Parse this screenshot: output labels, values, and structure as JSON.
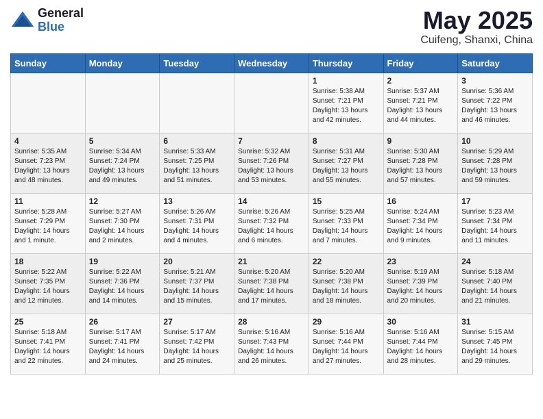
{
  "logo": {
    "general": "General",
    "blue": "Blue"
  },
  "title": "May 2025",
  "subtitle": "Cuifeng, Shanxi, China",
  "days_of_week": [
    "Sunday",
    "Monday",
    "Tuesday",
    "Wednesday",
    "Thursday",
    "Friday",
    "Saturday"
  ],
  "weeks": [
    [
      {
        "day": "",
        "info": ""
      },
      {
        "day": "",
        "info": ""
      },
      {
        "day": "",
        "info": ""
      },
      {
        "day": "",
        "info": ""
      },
      {
        "day": "1",
        "info": "Sunrise: 5:38 AM\nSunset: 7:21 PM\nDaylight: 13 hours\nand 42 minutes."
      },
      {
        "day": "2",
        "info": "Sunrise: 5:37 AM\nSunset: 7:21 PM\nDaylight: 13 hours\nand 44 minutes."
      },
      {
        "day": "3",
        "info": "Sunrise: 5:36 AM\nSunset: 7:22 PM\nDaylight: 13 hours\nand 46 minutes."
      }
    ],
    [
      {
        "day": "4",
        "info": "Sunrise: 5:35 AM\nSunset: 7:23 PM\nDaylight: 13 hours\nand 48 minutes."
      },
      {
        "day": "5",
        "info": "Sunrise: 5:34 AM\nSunset: 7:24 PM\nDaylight: 13 hours\nand 49 minutes."
      },
      {
        "day": "6",
        "info": "Sunrise: 5:33 AM\nSunset: 7:25 PM\nDaylight: 13 hours\nand 51 minutes."
      },
      {
        "day": "7",
        "info": "Sunrise: 5:32 AM\nSunset: 7:26 PM\nDaylight: 13 hours\nand 53 minutes."
      },
      {
        "day": "8",
        "info": "Sunrise: 5:31 AM\nSunset: 7:27 PM\nDaylight: 13 hours\nand 55 minutes."
      },
      {
        "day": "9",
        "info": "Sunrise: 5:30 AM\nSunset: 7:28 PM\nDaylight: 13 hours\nand 57 minutes."
      },
      {
        "day": "10",
        "info": "Sunrise: 5:29 AM\nSunset: 7:28 PM\nDaylight: 13 hours\nand 59 minutes."
      }
    ],
    [
      {
        "day": "11",
        "info": "Sunrise: 5:28 AM\nSunset: 7:29 PM\nDaylight: 14 hours\nand 1 minute."
      },
      {
        "day": "12",
        "info": "Sunrise: 5:27 AM\nSunset: 7:30 PM\nDaylight: 14 hours\nand 2 minutes."
      },
      {
        "day": "13",
        "info": "Sunrise: 5:26 AM\nSunset: 7:31 PM\nDaylight: 14 hours\nand 4 minutes."
      },
      {
        "day": "14",
        "info": "Sunrise: 5:26 AM\nSunset: 7:32 PM\nDaylight: 14 hours\nand 6 minutes."
      },
      {
        "day": "15",
        "info": "Sunrise: 5:25 AM\nSunset: 7:33 PM\nDaylight: 14 hours\nand 7 minutes."
      },
      {
        "day": "16",
        "info": "Sunrise: 5:24 AM\nSunset: 7:34 PM\nDaylight: 14 hours\nand 9 minutes."
      },
      {
        "day": "17",
        "info": "Sunrise: 5:23 AM\nSunset: 7:34 PM\nDaylight: 14 hours\nand 11 minutes."
      }
    ],
    [
      {
        "day": "18",
        "info": "Sunrise: 5:22 AM\nSunset: 7:35 PM\nDaylight: 14 hours\nand 12 minutes."
      },
      {
        "day": "19",
        "info": "Sunrise: 5:22 AM\nSunset: 7:36 PM\nDaylight: 14 hours\nand 14 minutes."
      },
      {
        "day": "20",
        "info": "Sunrise: 5:21 AM\nSunset: 7:37 PM\nDaylight: 14 hours\nand 15 minutes."
      },
      {
        "day": "21",
        "info": "Sunrise: 5:20 AM\nSunset: 7:38 PM\nDaylight: 14 hours\nand 17 minutes."
      },
      {
        "day": "22",
        "info": "Sunrise: 5:20 AM\nSunset: 7:38 PM\nDaylight: 14 hours\nand 18 minutes."
      },
      {
        "day": "23",
        "info": "Sunrise: 5:19 AM\nSunset: 7:39 PM\nDaylight: 14 hours\nand 20 minutes."
      },
      {
        "day": "24",
        "info": "Sunrise: 5:18 AM\nSunset: 7:40 PM\nDaylight: 14 hours\nand 21 minutes."
      }
    ],
    [
      {
        "day": "25",
        "info": "Sunrise: 5:18 AM\nSunset: 7:41 PM\nDaylight: 14 hours\nand 22 minutes."
      },
      {
        "day": "26",
        "info": "Sunrise: 5:17 AM\nSunset: 7:41 PM\nDaylight: 14 hours\nand 24 minutes."
      },
      {
        "day": "27",
        "info": "Sunrise: 5:17 AM\nSunset: 7:42 PM\nDaylight: 14 hours\nand 25 minutes."
      },
      {
        "day": "28",
        "info": "Sunrise: 5:16 AM\nSunset: 7:43 PM\nDaylight: 14 hours\nand 26 minutes."
      },
      {
        "day": "29",
        "info": "Sunrise: 5:16 AM\nSunset: 7:44 PM\nDaylight: 14 hours\nand 27 minutes."
      },
      {
        "day": "30",
        "info": "Sunrise: 5:16 AM\nSunset: 7:44 PM\nDaylight: 14 hours\nand 28 minutes."
      },
      {
        "day": "31",
        "info": "Sunrise: 5:15 AM\nSunset: 7:45 PM\nDaylight: 14 hours\nand 29 minutes."
      }
    ]
  ]
}
